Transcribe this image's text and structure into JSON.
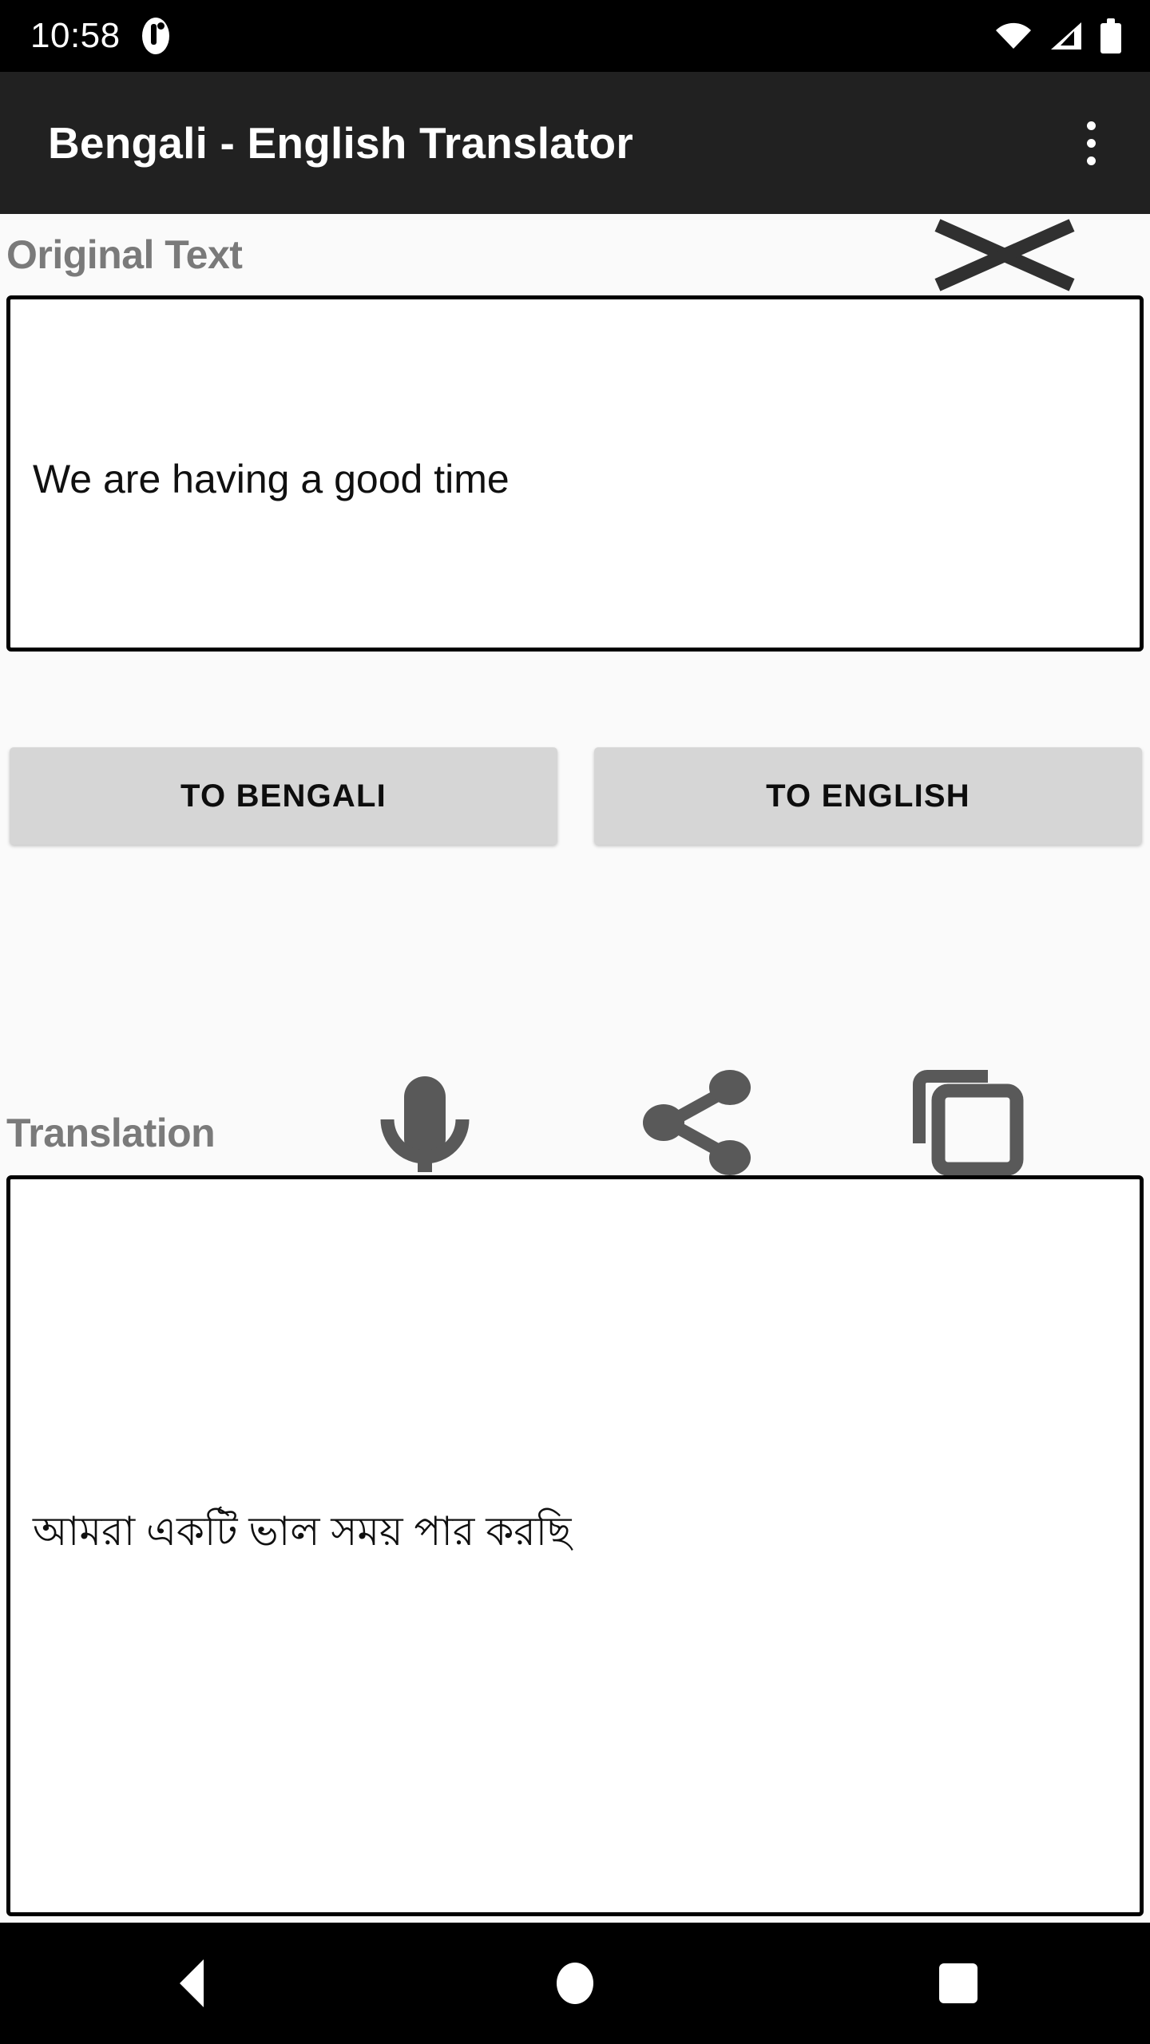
{
  "status_bar": {
    "clock": "10:58",
    "icons": [
      "notification-icon",
      "wifi-icon",
      "cellular-signal-icon",
      "battery-icon"
    ]
  },
  "app_bar": {
    "title": "Bengali - English Translator",
    "overflow_menu_name": "more-options"
  },
  "original_section": {
    "label": "Original Text",
    "clear_icon": "close-icon",
    "input_value": "We are having a good time",
    "input_placeholder": ""
  },
  "actions": {
    "to_bengali_label": "TO BENGALI",
    "to_english_label": "TO ENGLISH"
  },
  "translation_section": {
    "label": "Translation",
    "icons": [
      "microphone-icon",
      "share-icon",
      "copy-icon"
    ],
    "output_value": "আমরা একটি ভাল সময় পার করছি"
  },
  "nav_bar": {
    "back": "back-button",
    "home": "home-button",
    "recents": "recents-button"
  },
  "colors": {
    "status_bar_bg": "#000000",
    "app_bar_bg": "#212121",
    "page_bg": "#fafafa",
    "button_bg": "#d6d6d6",
    "label_gray": "#7a7a7a",
    "icon_gray": "#595959",
    "box_border": "#000000"
  }
}
